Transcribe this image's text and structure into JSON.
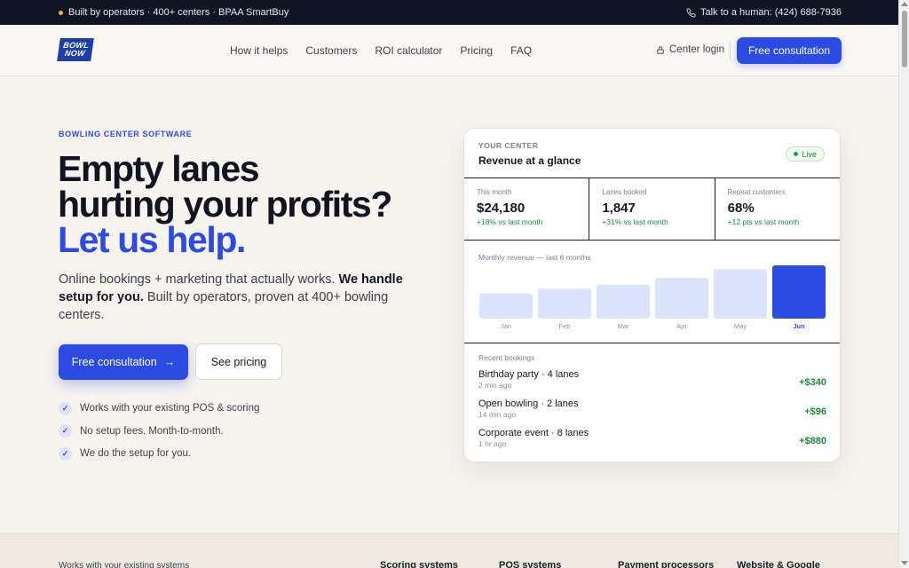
{
  "topbar": {
    "tagline": "Built by operators · 400+ centers · BPAA SmartBuy",
    "phone": "Talk to a human: (424) 688-7936"
  },
  "nav": {
    "logo_text": "BOWL NOW",
    "links": [
      "How it helps",
      "Customers",
      "ROI calculator",
      "Pricing",
      "FAQ"
    ],
    "login": "Center login",
    "cta": "Free consultation"
  },
  "hero": {
    "eyebrow": "BOWLING CENTER SOFTWARE",
    "headline_line1": "Empty lanes",
    "headline_line2": "hurting your profits?",
    "headline_accent": "Let us help.",
    "sub_plain1": "Online bookings + marketing that actually works. ",
    "sub_bold": "We handle setup for you.",
    "sub_plain2": " Built by operators, proven at 400+ bowling centers.",
    "primary_cta": "Free consultation",
    "secondary_cta": "See pricing",
    "checks": [
      "Works with your existing POS & scoring",
      "No setup fees. Month-to-month.",
      "We do the setup for you."
    ]
  },
  "card": {
    "eyebrow": "YOUR CENTER",
    "title": "Revenue at a glance",
    "live_label": "Live",
    "stats": [
      {
        "label": "This month",
        "value": "$24,180",
        "delta": "+18% vs last month"
      },
      {
        "label": "Lanes booked",
        "value": "1,847",
        "delta": "+31% vs last month"
      },
      {
        "label": "Repeat customers",
        "value": "68%",
        "delta": "+12 pts vs last month"
      }
    ],
    "chart_title": "Monthly revenue — last 6 months",
    "recent_title": "Recent bookings",
    "bookings": [
      {
        "name": "Birthday party · 4 lanes",
        "time": "2 min ago",
        "amount": "+$340"
      },
      {
        "name": "Open bowling · 2 lanes",
        "time": "14 min ago",
        "amount": "+$96"
      },
      {
        "name": "Corporate event · 8 lanes",
        "time": "1 hr ago",
        "amount": "+$880"
      }
    ]
  },
  "chart_data": {
    "type": "bar",
    "categories": [
      "Jan",
      "Feb",
      "Mar",
      "Apr",
      "May",
      "Jun"
    ],
    "values": [
      26,
      31,
      35,
      42,
      51,
      55
    ],
    "highlight": "Jun",
    "colors": {
      "bar": "#dce3fc",
      "highlight": "#2c4be2"
    }
  },
  "footer_strip": {
    "label": "Works with your existing systems",
    "categories": [
      "Scoring systems",
      "POS systems",
      "Payment processors",
      "Website & Google"
    ]
  },
  "colors": {
    "accent": "#2c4be2",
    "topbar": "#0f1524",
    "success": "#1e8a3c"
  }
}
